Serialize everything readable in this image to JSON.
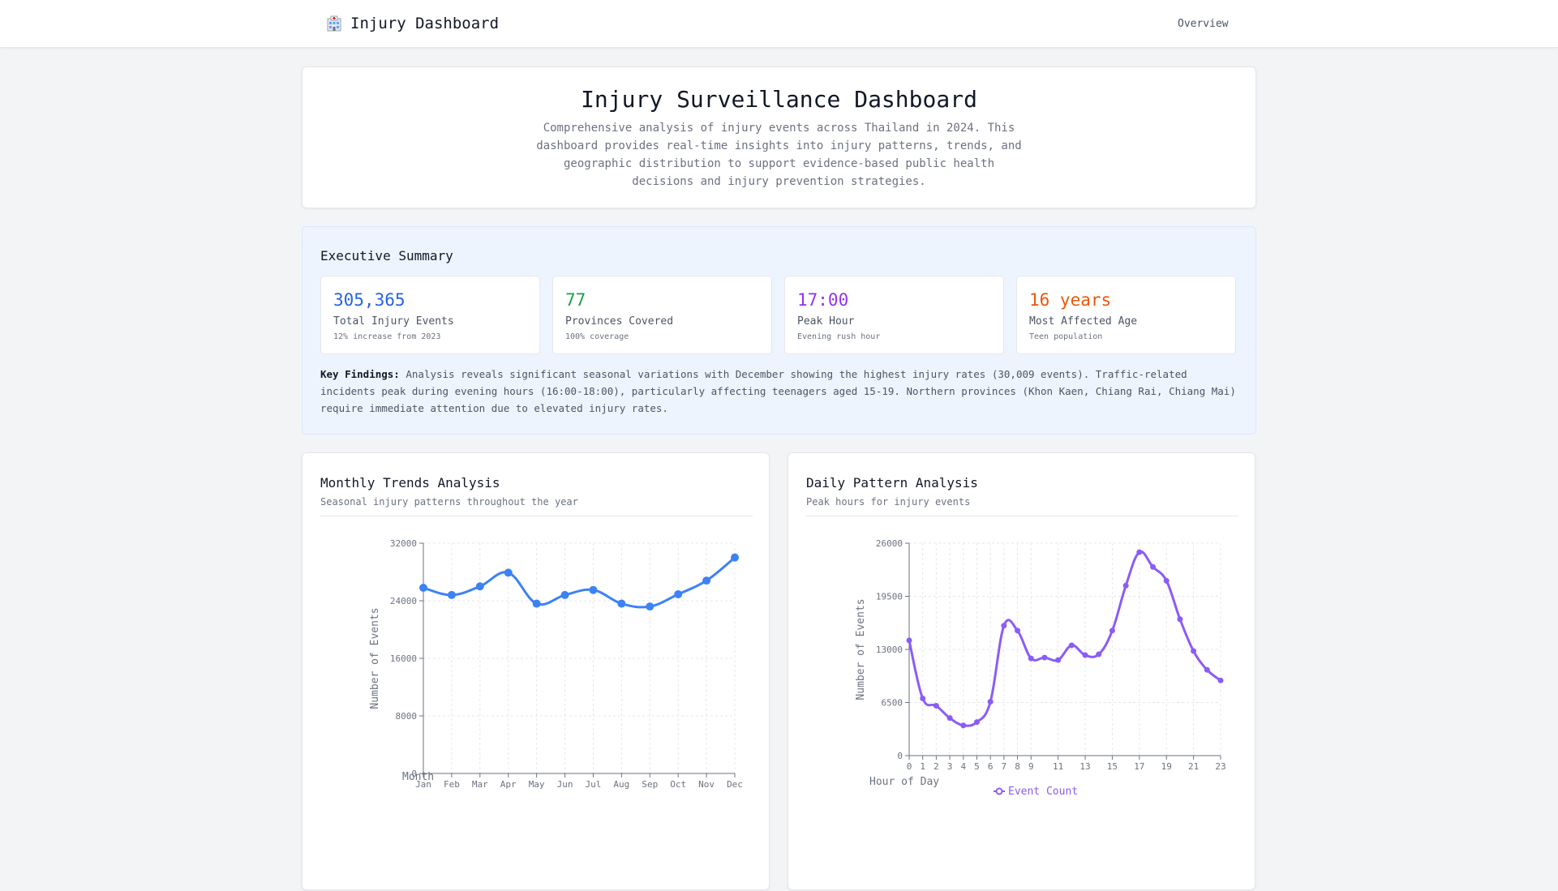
{
  "header": {
    "brand": "Injury Dashboard",
    "brand_icon": "hospital-icon",
    "nav": [
      "Overview"
    ]
  },
  "hero": {
    "title": "Injury Surveillance Dashboard",
    "description": "Comprehensive analysis of injury events across Thailand in 2024. This dashboard provides real-time insights into injury patterns, trends, and geographic distribution to support evidence-based public health decisions and injury prevention strategies."
  },
  "summary": {
    "title": "Executive Summary",
    "stats": [
      {
        "value": "305,365",
        "label": "Total Injury Events",
        "sub": "12% increase from 2023",
        "color": "#2563eb"
      },
      {
        "value": "77",
        "label": "Provinces Covered",
        "sub": "100% coverage",
        "color": "#16a34a"
      },
      {
        "value": "17:00",
        "label": "Peak Hour",
        "sub": "Evening rush hour",
        "color": "#9333ea"
      },
      {
        "value": "16 years",
        "label": "Most Affected Age",
        "sub": "Teen population",
        "color": "#ea580c"
      }
    ],
    "findings_label": "Key Findings:",
    "findings_text": "Analysis reveals significant seasonal variations with December showing the highest injury rates (30,009 events). Traffic-related incidents peak during evening hours (16:00-18:00), particularly affecting teenagers aged 15-19. Northern provinces (Khon Kaen, Chiang Rai, Chiang Mai) require immediate attention due to elevated injury rates."
  },
  "monthly": {
    "title": "Monthly Trends Analysis",
    "subtitle": "Seasonal injury patterns throughout the year"
  },
  "daily": {
    "title": "Daily Pattern Analysis",
    "subtitle": "Peak hours for injury events"
  },
  "chart_data": [
    {
      "type": "line",
      "title": "",
      "xlabel": "Month",
      "ylabel": "Number of Events",
      "ylim": [
        0,
        32000
      ],
      "yticks": [
        0,
        8000,
        16000,
        24000,
        32000
      ],
      "grid": true,
      "color": "#3b82f6",
      "categories": [
        "Jan",
        "Feb",
        "Mar",
        "Apr",
        "May",
        "Jun",
        "Jul",
        "Aug",
        "Sep",
        "Oct",
        "Nov",
        "Dec"
      ],
      "values": [
        25800,
        24800,
        26000,
        27900,
        23600,
        24800,
        25500,
        23600,
        23200,
        24900,
        26800,
        30009
      ]
    },
    {
      "type": "line",
      "title": "",
      "xlabel": "Hour of Day",
      "ylabel": "Number of Events",
      "ylim": [
        0,
        26000
      ],
      "yticks": [
        0,
        6500,
        13000,
        19500,
        26000
      ],
      "xticks": [
        0,
        1,
        2,
        3,
        4,
        5,
        6,
        7,
        8,
        9,
        11,
        13,
        15,
        17,
        19,
        21,
        23
      ],
      "grid": true,
      "legend": "bottom",
      "color": "#8b5cf6",
      "series": [
        {
          "name": "Event Count",
          "x": [
            0,
            1,
            2,
            3,
            4,
            5,
            6,
            7,
            8,
            9,
            10,
            11,
            12,
            13,
            14,
            15,
            16,
            17,
            18,
            19,
            20,
            21,
            22,
            23
          ],
          "values": [
            14100,
            7000,
            6100,
            4600,
            3700,
            4100,
            6600,
            15900,
            15300,
            11900,
            12000,
            11700,
            13500,
            12300,
            12400,
            15300,
            20800,
            24900,
            23100,
            21400,
            16700,
            12800,
            10500,
            9200
          ]
        }
      ]
    }
  ]
}
